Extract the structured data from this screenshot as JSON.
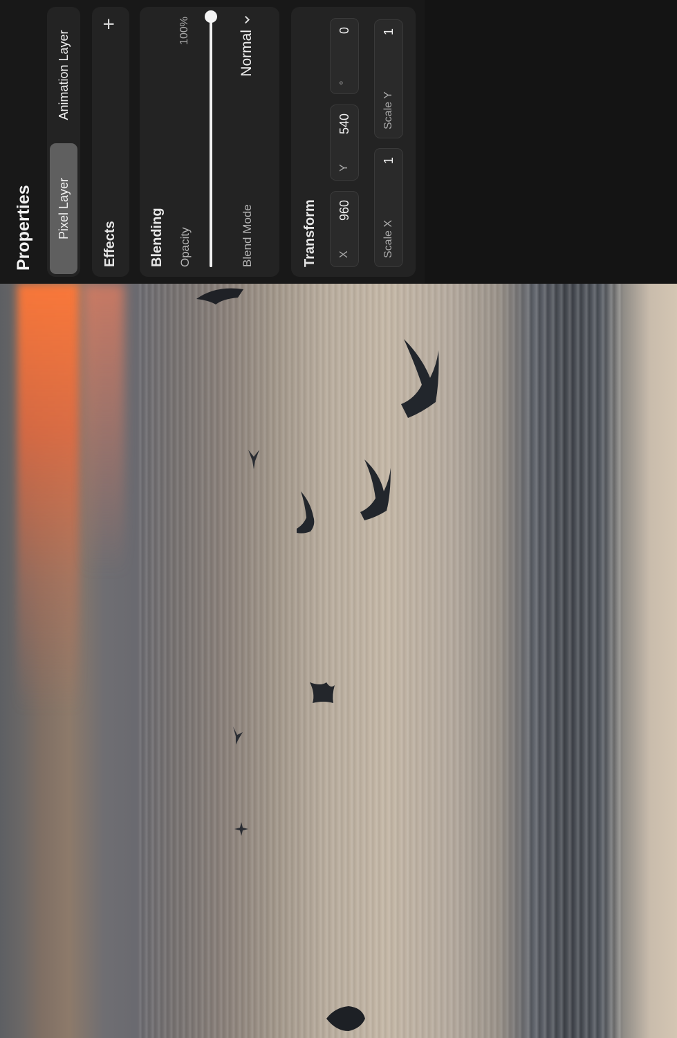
{
  "panel": {
    "title": "Properties",
    "layer_tabs": [
      {
        "label": "Pixel Layer",
        "active": true
      },
      {
        "label": "Animation Layer",
        "active": false
      }
    ],
    "effects": {
      "label": "Effects",
      "add_icon": "plus-icon"
    },
    "blending": {
      "title": "Blending",
      "opacity_label": "Opacity",
      "opacity_value": "100%",
      "opacity_fraction": 1.0,
      "blend_mode_label": "Blend Mode",
      "blend_mode_value": "Normal",
      "blend_mode_icon": "chevron-down-icon"
    },
    "transform": {
      "title": "Transform",
      "x_label": "X",
      "x_value": "960",
      "y_label": "Y",
      "y_value": "540",
      "rotation_unit": "°",
      "rotation_value": "0",
      "scale_x_label": "Scale X",
      "scale_x_value": "1",
      "scale_y_label": "Scale Y",
      "scale_y_value": "1"
    }
  },
  "colors": {
    "panel_background": "#181818",
    "card_background": "#232323",
    "active_tab": "#5f5f5f",
    "text": "#f0f0f0"
  }
}
